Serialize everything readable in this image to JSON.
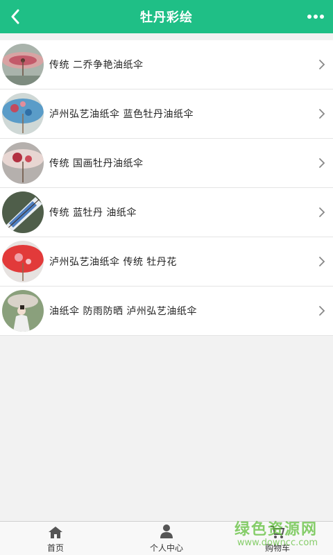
{
  "header": {
    "title": "牡丹彩绘"
  },
  "items": [
    {
      "label": "传统 二乔争艳油纸伞",
      "image": "umbrella-red-pink"
    },
    {
      "label": "泸州弘艺油纸伞 蓝色牡丹油纸伞",
      "image": "umbrella-blue"
    },
    {
      "label": "传统 国画牡丹油纸伞",
      "image": "umbrella-peony-red"
    },
    {
      "label": "传统 蓝牡丹 油纸伞",
      "image": "umbrella-blue-side"
    },
    {
      "label": "泸州弘艺油纸伞 传统 牡丹花",
      "image": "umbrella-red"
    },
    {
      "label": "油纸伞 防雨防晒 泸州弘艺油纸伞",
      "image": "woman-with-umbrella"
    }
  ],
  "tabbar": {
    "home": "首页",
    "profile": "个人中心",
    "cart": "购物车"
  },
  "watermark": {
    "line1": "绿色资源网",
    "line2": "www.downcc.com"
  },
  "colors": {
    "accent": "#1fbf86",
    "watermark": "#5fbf3a"
  }
}
